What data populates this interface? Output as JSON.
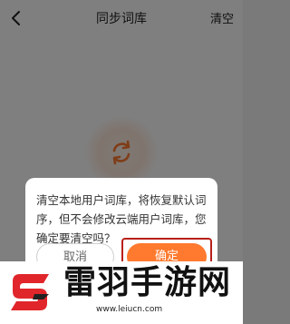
{
  "navbar": {
    "title": "同步词库",
    "action_label": "清空",
    "back_icon": "chevron-left-icon"
  },
  "main": {
    "sync_icon": "sync-icon",
    "accent_color": "#ff7a2e"
  },
  "dialog": {
    "message": "清空本地用户词库，将恢复默认词序，但不会修改云端用户词库，您确定要清空吗？",
    "cancel_label": "取消",
    "confirm_label": "确定"
  },
  "watermark": {
    "title": "雷羽手游网",
    "url": "www.leiucn.com",
    "logo_color": "#e0262b"
  }
}
